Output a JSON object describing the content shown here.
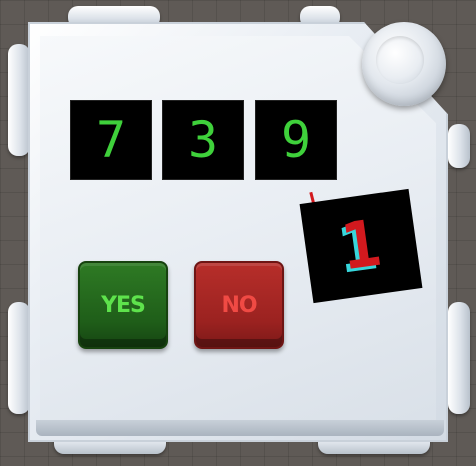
{
  "module": {
    "display_digits": [
      "7",
      "3",
      "9"
    ],
    "side_display_digit": "1",
    "buttons": {
      "yes_label": "YES",
      "no_label": "NO"
    }
  },
  "colors": {
    "digit_green": "#3fd13b",
    "side_digit_red": "#d2191e",
    "side_digit_cyan": "#37d6dc",
    "yes_button": "#2e7a24",
    "no_button": "#b72e2a",
    "housing": "#e8edf3"
  },
  "icons": {
    "status_light": "status-light-icon"
  }
}
